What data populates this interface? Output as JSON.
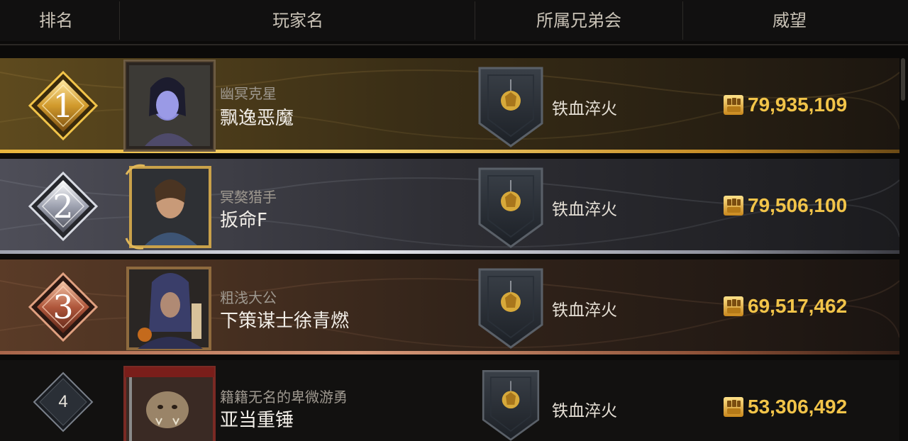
{
  "header": {
    "rank": "排名",
    "player": "玩家名",
    "brotherhood": "所属兄弟会",
    "fame": "威望"
  },
  "rows": [
    {
      "rank": "1",
      "title": "幽冥克星",
      "name": "飘逸恶魔",
      "guild": "铁血淬火",
      "fame": "79,935,109",
      "portrait": "player-portrait-elf-woman"
    },
    {
      "rank": "2",
      "title": "冥獒猎手",
      "name": "扳命F",
      "guild": "铁血淬火",
      "fame": "79,506,100",
      "portrait": "player-portrait-warrior-man"
    },
    {
      "rank": "3",
      "title": "粗浅大公",
      "name": "下策谋士徐青燃",
      "guild": "铁血淬火",
      "fame": "69,517,462",
      "portrait": "player-portrait-hooded-rogue"
    },
    {
      "rank": "4",
      "title": "籍籍无名的卑微游勇",
      "name": "亚当重锤",
      "guild": "铁血淬火",
      "fame": "53,306,492",
      "portrait": "player-portrait-orc"
    }
  ],
  "colors": {
    "gold_accent": "#f2c449",
    "rank1_tint": "#6b5424",
    "rank2_tint": "#4a4a52",
    "rank3_tint": "#5a3a26",
    "rank4_tint": "#141312"
  },
  "icons": {
    "fame": "fist-icon",
    "guild": "lion-banner-icon"
  }
}
